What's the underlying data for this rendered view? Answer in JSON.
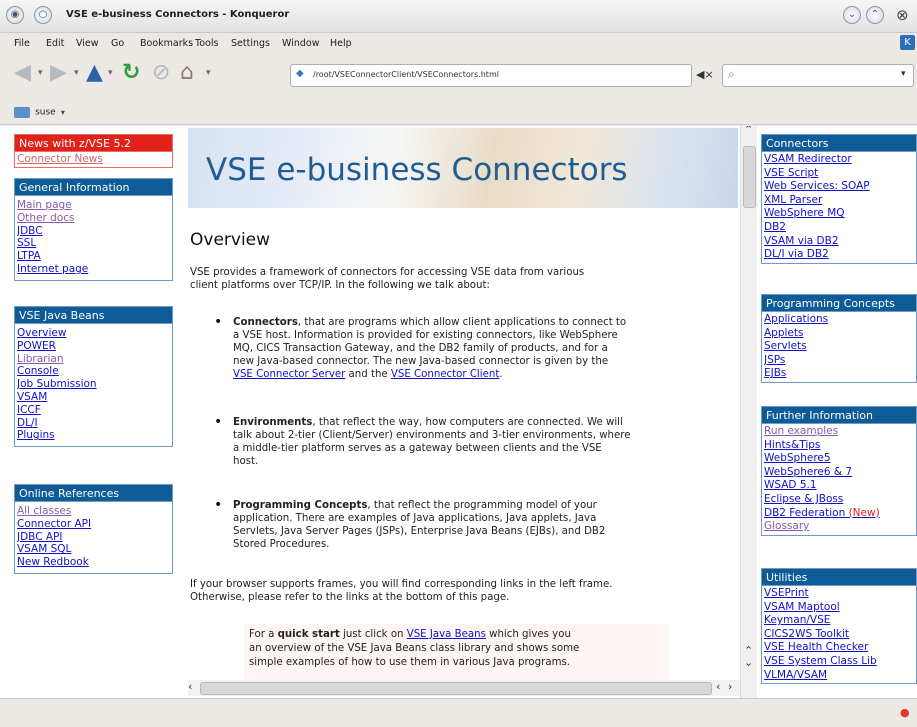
{
  "window": {
    "title": "VSE e-business Connectors - Konqueror"
  },
  "menubar": [
    "File",
    "Edit",
    "View",
    "Go",
    "Bookmarks",
    "Tools",
    "Settings",
    "Window",
    "Help"
  ],
  "toolbar": {
    "url": "/root/VSEConnectorClient/VSEConnectors.html"
  },
  "bookmarks": {
    "folder": "suse"
  },
  "left_nav": {
    "news_header": "News with z/VSE 5.2",
    "news_links": [
      "Connector News"
    ],
    "general_header": "General Information",
    "general_links": [
      "Main page",
      "Other docs",
      "JDBC",
      "SSL",
      "LTPA",
      "Internet page"
    ],
    "beans_header": "VSE Java Beans",
    "beans_links": [
      "Overview",
      "POWER",
      "Librarian",
      "Console",
      "Job Submission",
      "VSAM",
      "ICCF",
      "DL/I",
      "Plugins"
    ],
    "refs_header": "Online References",
    "refs_links": [
      "All classes",
      "Connector API",
      "JDBC API",
      "VSAM SQL",
      "New Redbook"
    ]
  },
  "main": {
    "banner_title": "VSE e-business Connectors",
    "heading": "Overview",
    "intro_line1": "VSE provides a framework of connectors for accessing VSE data from various",
    "intro_line2": "client platforms over TCP/IP. In the following we talk about:",
    "b1_bold": "Connectors",
    "b1_l1": ", that are programs which allow client applications to connect to",
    "b1_l2": "a VSE host. Information is provided for existing connectors, like WebSphere",
    "b1_l3": "MQ, CICS Transaction Gateway, and the DB2 family of products, and for a",
    "b1_l4": "new Java-based connector. The new Java-based connector is given by the",
    "b1_link1": "VSE Connector Server",
    "b1_and": " and the ",
    "b1_link2": "VSE Connector Client",
    "b1_end": ".",
    "b2_bold": "Environments",
    "b2_l1": ", that reflect the way, how computers are connected. We will",
    "b2_l2": "talk about 2-tier (Client/Server) environments and 3-tier environments, where",
    "b2_l3": "a middle-tier platform serves as a gateway between clients and the VSE",
    "b2_l4": "host.",
    "b3_bold": "Programming Concepts",
    "b3_l1": ", that reflect the programming model of your",
    "b3_l2": "application. There are examples of Java applications, Java applets, Java",
    "b3_l3": "Servlets, Java Server Pages (JSPs), Enterprise Java Beans (EJBs), and DB2",
    "b3_l4": "Stored Procedures.",
    "frames_l1": "If your browser supports frames, you will find corresponding links in the left frame.",
    "frames_l2": "Otherwise, please refer to the links at the bottom of this page.",
    "qs_pre": "For a ",
    "qs_bold": "quick start",
    "qs_mid": " just click on ",
    "qs_link": "VSE Java Beans",
    "qs_l1_end": " which gives you",
    "qs_l2": "an overview of the VSE Java Beans class library and shows some",
    "qs_l3": "simple examples of how to use them in various Java programs."
  },
  "right_nav": {
    "connectors_header": "Connectors",
    "connectors_links": [
      "VSAM Redirector",
      "VSE Script",
      "Web Services: SOAP",
      "XML Parser",
      "WebSphere MQ",
      "DB2",
      "VSAM via DB2",
      "DL/I via DB2"
    ],
    "concepts_header": "Programming Concepts",
    "concepts_links": [
      "Applications",
      "Applets",
      "Servlets",
      "JSPs",
      "EJBs"
    ],
    "further_header": "Further Information",
    "further_links": [
      "Run examples",
      "Hints&Tips",
      "WebSphere5",
      "WebSphere6 & 7",
      "WSAD 5.1",
      "Eclipse & JBoss",
      "DB2 Federation",
      "Glossary"
    ],
    "further_new": "(New)",
    "utilities_header": "Utilities",
    "utilities_links": [
      "VSEPrint",
      "VSAM Maptool",
      "Keyman/VSE",
      "CICS2WS Toolkit",
      "VSE Health Checker",
      "VSE System Class Lib",
      "VLMA/VSAM"
    ]
  },
  "colors": {
    "nav_header": "#0f5b98",
    "news_header": "#e0221a",
    "link": "#1010c8",
    "banner_text": "#1f5c94"
  }
}
